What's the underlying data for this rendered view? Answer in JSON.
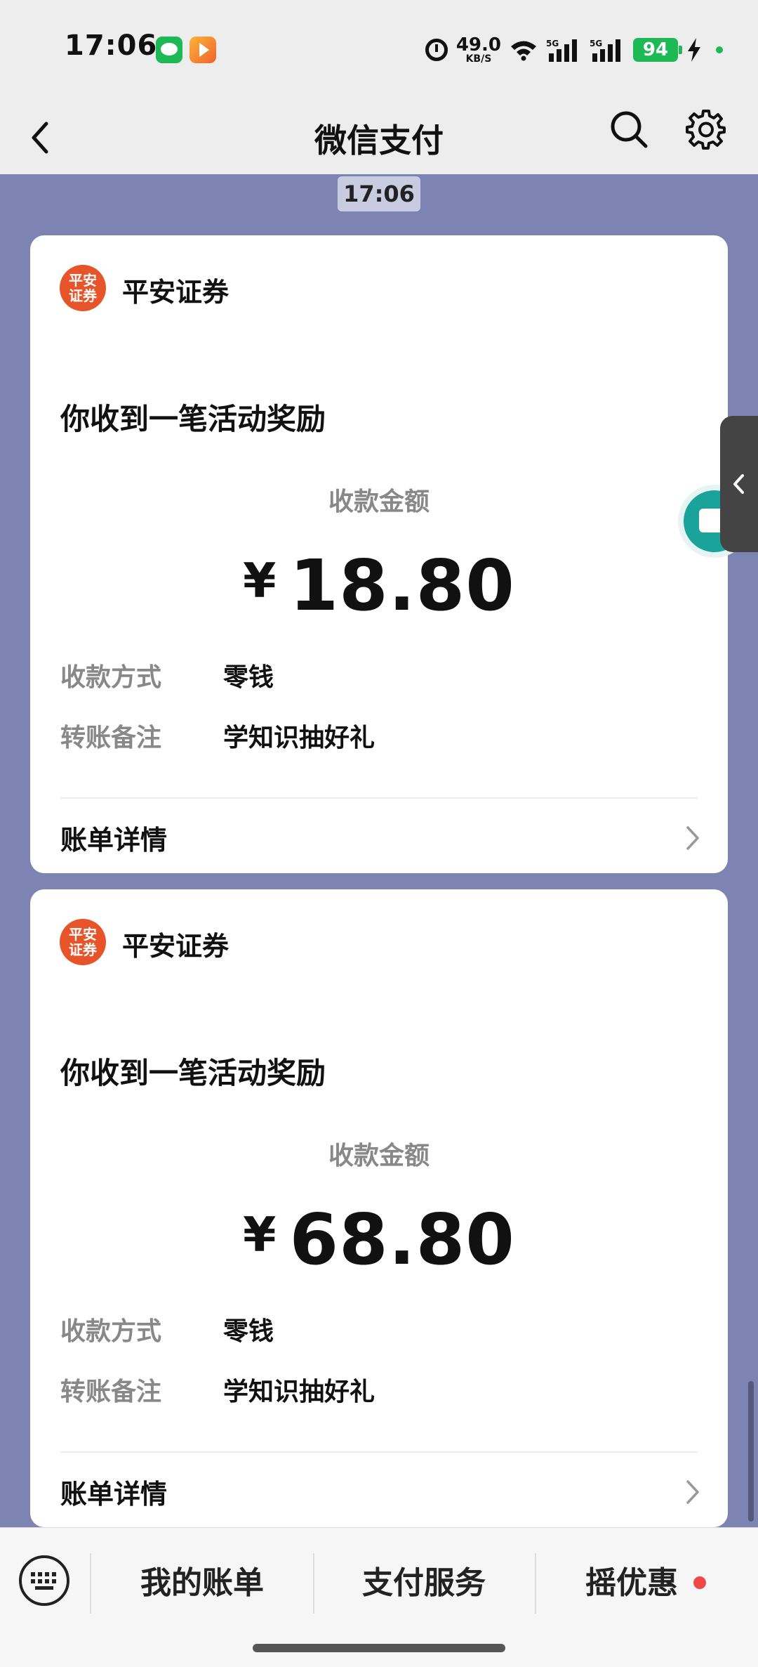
{
  "status_bar": {
    "time": "17:06",
    "net_speed_value": "49.0",
    "net_speed_unit": "KB/S",
    "signal_1_label": "5G",
    "signal_2_label": "5G",
    "battery": "94",
    "apps": [
      "wechat-icon",
      "video-app-icon"
    ]
  },
  "nav": {
    "title": "微信支付",
    "icons": [
      "back-arrow-icon",
      "search-icon",
      "gear-icon"
    ]
  },
  "timestamp": "17:06",
  "messages": [
    {
      "merchant": "平安证券",
      "merchant_logo_text": "平安证券",
      "title": "你收到一笔活动奖励",
      "amount_label": "收款金额",
      "currency": "¥",
      "amount": "18.80",
      "fields": [
        {
          "key": "收款方式",
          "value": "零钱"
        },
        {
          "key": "转账备注",
          "value": "学知识抽好礼"
        }
      ],
      "link": "账单详情"
    },
    {
      "merchant": "平安证券",
      "merchant_logo_text": "平安证券",
      "title": "你收到一笔活动奖励",
      "amount_label": "收款金额",
      "currency": "¥",
      "amount": "68.80",
      "fields": [
        {
          "key": "收款方式",
          "value": "零钱"
        },
        {
          "key": "转账备注",
          "value": "学知识抽好礼"
        }
      ],
      "link": "账单详情"
    }
  ],
  "bottom_menu": [
    {
      "label": "我的账单"
    },
    {
      "label": "支付服务"
    },
    {
      "label": "摇优惠",
      "badge_color": "#f04848"
    }
  ],
  "colors": {
    "chat_background": "#7d84b4",
    "accent_green": "#1db954",
    "merchant_logo": "#e8542a"
  }
}
